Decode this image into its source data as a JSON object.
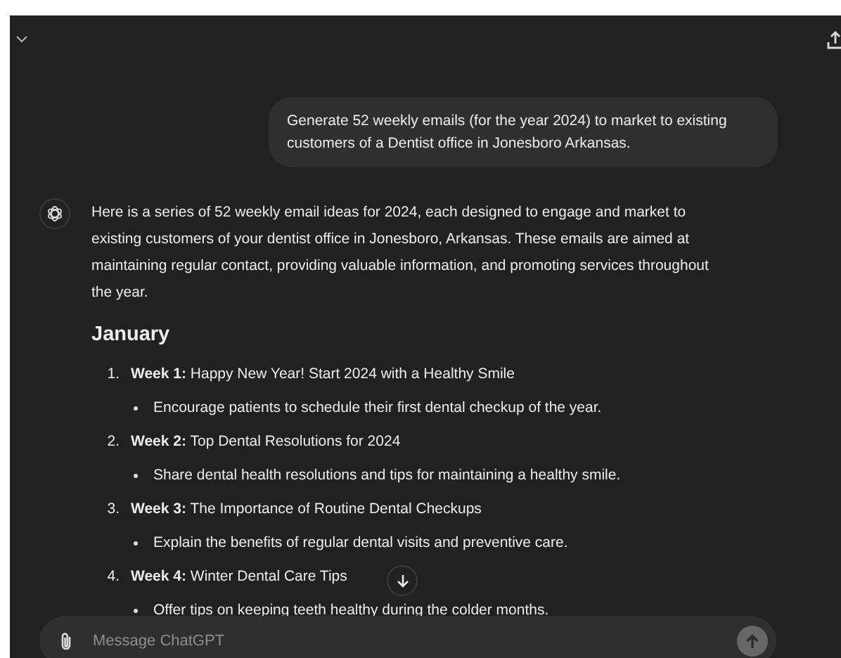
{
  "user_message": "Generate 52 weekly emails (for the year 2024) to market to existing customers of a  Dentist office in Jonesboro Arkansas.",
  "assistant": {
    "intro": "Here is a series of 52 weekly email ideas for 2024, each designed to engage and market to existing customers of your dentist office in Jonesboro, Arkansas. These emails are aimed at maintaining regular contact, providing valuable information, and promoting services throughout the year.",
    "heading": "January",
    "items": [
      {
        "number": "1.",
        "title": "**Week 1:** Happy New Year! Start 2024 with a Healthy Smile",
        "bullets": [
          "Encourage patients to schedule their first dental checkup of the year."
        ]
      },
      {
        "number": "2.",
        "title": "**Week 2:** Top Dental Resolutions for 2024",
        "bullets": [
          "Share dental health resolutions and tips for maintaining a healthy smile."
        ]
      },
      {
        "number": "3.",
        "title": "**Week 3:** The Importance of Routine Dental Checkups",
        "bullets": [
          "Explain the benefits of regular dental visits and preventive care."
        ]
      },
      {
        "number": "4.",
        "title": "**Week 4:** Winter Dental Care Tips",
        "bullets": [
          "Offer tips on keeping teeth healthy during the colder months."
        ]
      }
    ]
  },
  "composer": {
    "placeholder": "Message ChatGPT",
    "send_disabled": true
  }
}
